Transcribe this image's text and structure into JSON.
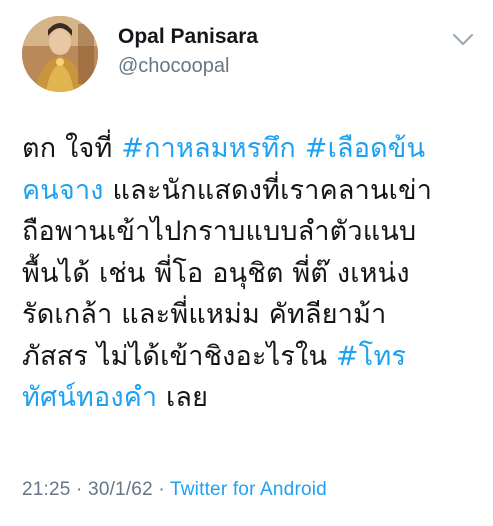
{
  "author": {
    "display_name": "Opal Panisara",
    "handle": "@chocoopal"
  },
  "tweet": {
    "lines": [
      [
        {
          "t": "ตก ใจที่ ",
          "tag": false
        },
        {
          "t": "#กาหลมหรทึก",
          "tag": true
        },
        {
          "t": " ",
          "tag": false
        },
        {
          "t": "#เลือดข้น",
          "tag": true
        }
      ],
      [
        {
          "t": "คนจาง",
          "tag": true
        },
        {
          "t": " และนักแสดงที่เราคลานเข่า",
          "tag": false
        }
      ],
      [
        {
          "t": "ถือพานเข้าไปกราบแบบลำตัวแนบ",
          "tag": false
        }
      ],
      [
        {
          "t": "พื้นได้ เช่น พี่โอ อนุชิต  พี่ต๊ งเหน่ง",
          "tag": false
        }
      ],
      [
        {
          "t": "รัดเกล้า และพี่แหม่ม คัทลียาม้า",
          "tag": false
        }
      ],
      [
        {
          "t": "ภัสสร ไม่ได้เข้าชิงอะไรใน ",
          "tag": false
        },
        {
          "t": "#โทร",
          "tag": true
        }
      ],
      [
        {
          "t": "ทัศน์ทองคำ",
          "tag": true
        },
        {
          "t": " เลย",
          "tag": false
        }
      ]
    ]
  },
  "meta": {
    "time": "21:25",
    "separator1": " · ",
    "date": "30/1/62",
    "separator2": " · ",
    "source": "Twitter for Android"
  },
  "icons": {
    "menu": "chevron-down-icon",
    "avatar": "profile-photo"
  },
  "colors": {
    "link": "#1da1f2",
    "secondary": "#657786",
    "text": "#14171a"
  }
}
